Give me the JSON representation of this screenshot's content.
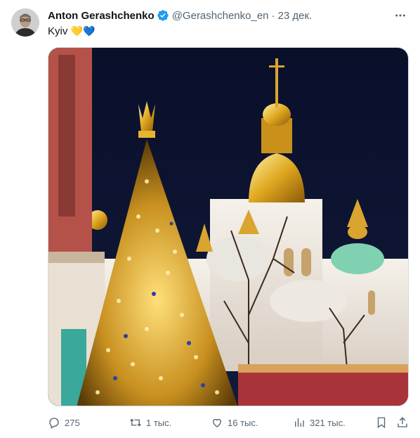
{
  "author": {
    "name": "Anton Gerashchenko",
    "handle": "@Gerashchenko_en",
    "separator": "·",
    "time": "23 дек."
  },
  "tweet": {
    "text": "Kyiv",
    "hearts": "💛💙"
  },
  "media": {
    "kind": "photo"
  },
  "actions": {
    "replies": "275",
    "retweets": "1 тыс.",
    "likes": "16 тыс.",
    "views": "321 тыс."
  },
  "colors": {
    "text": "#0f1419",
    "muted": "#536471",
    "verified": "#1d9bf0"
  },
  "icons": [
    "more-icon",
    "verified-icon",
    "reply-icon",
    "retweet-icon",
    "like-icon",
    "views-icon",
    "bookmark-icon",
    "share-icon"
  ]
}
